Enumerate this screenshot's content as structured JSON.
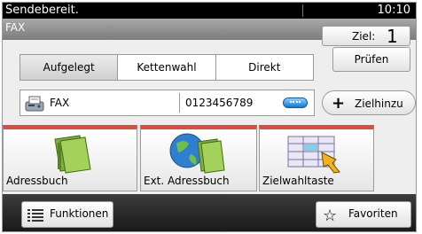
{
  "status": {
    "message": "Sendebereit.",
    "time": "10:10"
  },
  "title": "FAX",
  "ziel": {
    "label": "Ziel:",
    "count": "1"
  },
  "pruefen_label": "Prüfen",
  "tabs": [
    {
      "label": "Aufgelegt",
      "active": true
    },
    {
      "label": "Kettenwahl",
      "active": false
    },
    {
      "label": "Direkt",
      "active": false
    }
  ],
  "destination": {
    "type": "FAX",
    "number": "0123456789"
  },
  "zielhinzu_label": "Zielhinzu",
  "cards": [
    {
      "label": "Adressbuch",
      "icon": "address-book-icon"
    },
    {
      "label": "Ext. Adressbuch",
      "icon": "external-address-book-icon"
    },
    {
      "label": "Zielwahltaste",
      "icon": "one-touch-key-icon"
    }
  ],
  "bottom": {
    "functions_label": "Funktionen",
    "favorites_label": "Favoriten"
  },
  "colors": {
    "status_bg": "#000000",
    "card_accent": "#e24b3c",
    "bottom_bar": "#1a1a1a",
    "more_button": "#1177d6"
  }
}
